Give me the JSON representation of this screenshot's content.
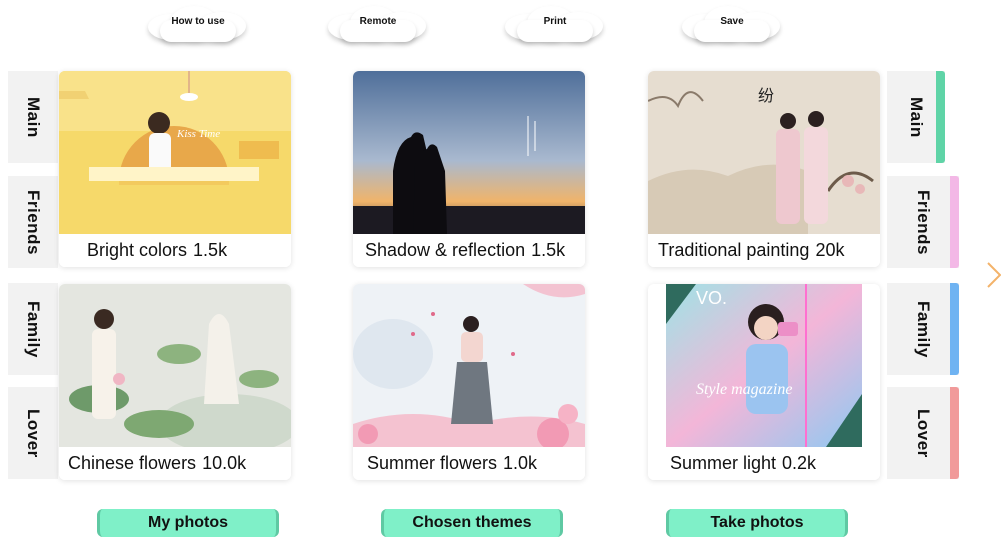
{
  "top_menu": {
    "how_to_use": "How to use",
    "remote": "Remote",
    "print": "Print",
    "save": "Save"
  },
  "left_tabs": [
    "Main",
    "Friends",
    "Family",
    "Lover"
  ],
  "right_tabs": [
    {
      "label": "Main",
      "color": "#5fd4a7"
    },
    {
      "label": "Friends",
      "color": "#f3b8e6"
    },
    {
      "label": "Family",
      "color": "#6fb3f2"
    },
    {
      "label": "Lover",
      "color": "#f19a9a"
    }
  ],
  "cards": [
    {
      "title": "Bright colors",
      "count": "1.5k",
      "image": "yellow-studio-photo"
    },
    {
      "title": "Shadow & reflection",
      "count": "1.5k",
      "image": "sunset-silhouette-photo"
    },
    {
      "title": "Traditional painting ",
      "count": "20k",
      "image": "traditional-painting-photo"
    },
    {
      "title": "Chinese flowers",
      "count": "10.0k",
      "image": "lotus-peacock-photo"
    },
    {
      "title": "Summer flowers",
      "count": "1.0k",
      "image": "cherry-blossom-photo"
    },
    {
      "title": "Summer light",
      "count": "0.2k",
      "image": "style-magazine-photo"
    }
  ],
  "bottom_buttons": {
    "my_photos": "My photos",
    "chosen_themes": "Chosen themes",
    "take_photos": "Take photos"
  },
  "sign_text": "Kiss Time",
  "magazine_text": "Style magazine",
  "colors": {
    "button_bg": "#7ff0c8",
    "tab_bg": "#f2f2f2"
  }
}
